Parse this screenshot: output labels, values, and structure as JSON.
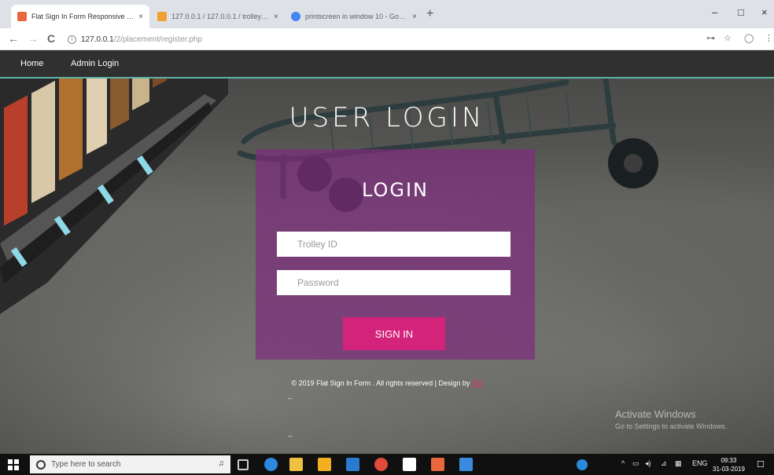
{
  "browser": {
    "tabs": [
      {
        "title": "Flat Sign In Form Responsive W...",
        "active": true,
        "favicon_color": "#e8673c"
      },
      {
        "title": "127.0.0.1 / 127.0.0.1 / trolley | ...",
        "active": false,
        "favicon_color": "#f0a030"
      },
      {
        "title": "printscreen in window 10 - Goo...",
        "active": false,
        "favicon_color": "#4285f4"
      }
    ],
    "close_glyph": "×",
    "new_tab_glyph": "+",
    "window_controls": {
      "minimize": "–",
      "maximize": "□",
      "close": "×"
    },
    "nav": {
      "back": "←",
      "forward": "→",
      "reload": "C"
    },
    "address": {
      "host": "127.0.0.1",
      "path": "/2/placement/register.php"
    },
    "address_right": {
      "key_icon": "⊶",
      "star_icon": "☆",
      "ext_icon": "◯",
      "menu_icon": "⋮"
    }
  },
  "site_nav": {
    "items": [
      {
        "label": "Home"
      },
      {
        "label": "Admin Login"
      }
    ]
  },
  "page": {
    "heading": "USER LOGIN",
    "login": {
      "title": "LOGIN",
      "trolley_placeholder": "Trolley ID",
      "password_placeholder": "Password",
      "submit_label": "SIGN IN"
    },
    "footer": {
      "text": "© 2019 Flat Sign In Form . All rights reserved | Design by",
      "design_link": "W3"
    },
    "dash_marks": [
      "_",
      "_"
    ],
    "watermark": {
      "line1": "Activate Windows",
      "line2": "Go to Settings to activate Windows."
    }
  },
  "taskbar": {
    "search_placeholder": "Type here to search",
    "mic_glyph": "♫",
    "tray": {
      "chevron": "^",
      "lang": "ENG"
    },
    "clock": {
      "time": "09:33",
      "date": "31-03-2019"
    },
    "icon_colors": {
      "edge": "#2b8ae0",
      "store": "#f0c040",
      "files": "#f0b020",
      "photos": "#2a7bd0",
      "chrome": "#e24a3b",
      "mail": "#ffffff",
      "app_orange": "#e8673c",
      "app_blue": "#3c8ae0",
      "start": "#ffffff"
    }
  },
  "colors": {
    "nav_bg": "#303030",
    "nav_accent": "#5fb3a6",
    "login_panel": "#7d2d7d",
    "signin_button": "#d4237a"
  }
}
